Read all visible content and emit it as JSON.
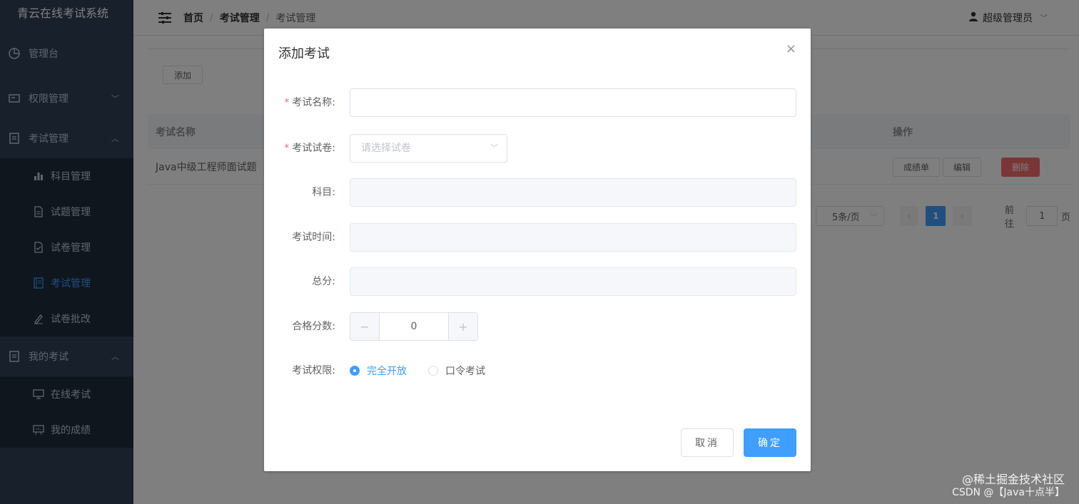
{
  "app": {
    "title": "青云在线考试系统"
  },
  "sidebar": {
    "items": [
      {
        "label": "管理台",
        "icon": "dashboard-icon"
      },
      {
        "label": "权限管理",
        "icon": "permission-icon"
      },
      {
        "label": "考试管理",
        "icon": "document-icon"
      }
    ],
    "exam_sub": [
      {
        "label": "科目管理",
        "icon": "bar-chart-icon"
      },
      {
        "label": "试题管理",
        "icon": "file-icon"
      },
      {
        "label": "试卷管理",
        "icon": "file-check-icon"
      },
      {
        "label": "考试管理",
        "icon": "notebook-icon",
        "active": true
      },
      {
        "label": "试卷批改",
        "icon": "edit-pen-icon"
      }
    ],
    "my_exam": {
      "label": "我的考试",
      "icon": "document-icon"
    },
    "my_sub": [
      {
        "label": "在线考试",
        "icon": "monitor-icon"
      },
      {
        "label": "我的成绩",
        "icon": "presentation-icon"
      }
    ]
  },
  "navbar": {
    "breadcrumb": [
      "首页",
      "考试管理",
      "考试管理"
    ],
    "separator": "/",
    "user": "超级管理员"
  },
  "page": {
    "add_button": "添加",
    "table": {
      "columns": [
        "考试名称",
        "操作"
      ],
      "rows": [
        {
          "name": "Java中级工程师面试题",
          "actions": [
            "成绩单",
            "编辑",
            "删除"
          ]
        }
      ]
    },
    "pagination": {
      "page_size": "5条/页",
      "current": "1",
      "goto_label": "前往",
      "goto_value": "1",
      "page_suffix": "页"
    }
  },
  "dialog": {
    "title": "添加考试",
    "close": "×",
    "fields": {
      "exam_name": {
        "label": "考试名称:",
        "required": true,
        "value": ""
      },
      "paper": {
        "label": "考试试卷:",
        "required": true,
        "placeholder": "请选择试卷"
      },
      "subject": {
        "label": "科目:"
      },
      "exam_time": {
        "label": "考试时间:"
      },
      "total_score": {
        "label": "总分:"
      },
      "pass_score": {
        "label": "合格分数:",
        "value": "0",
        "minus": "−",
        "plus": "+"
      },
      "permission": {
        "label": "考试权限:",
        "options": [
          "完全开放",
          "口令考试"
        ],
        "selected": "完全开放"
      }
    },
    "buttons": {
      "cancel": "取消",
      "confirm": "确定"
    }
  },
  "watermark": [
    "@稀土掘金技术社区",
    "CSDN @【Java十点半】"
  ],
  "colors": {
    "primary": "#409eff",
    "danger": "#f56c6c",
    "sidebar_bg": "#304156",
    "submenu_bg": "#1f2d3d"
  }
}
